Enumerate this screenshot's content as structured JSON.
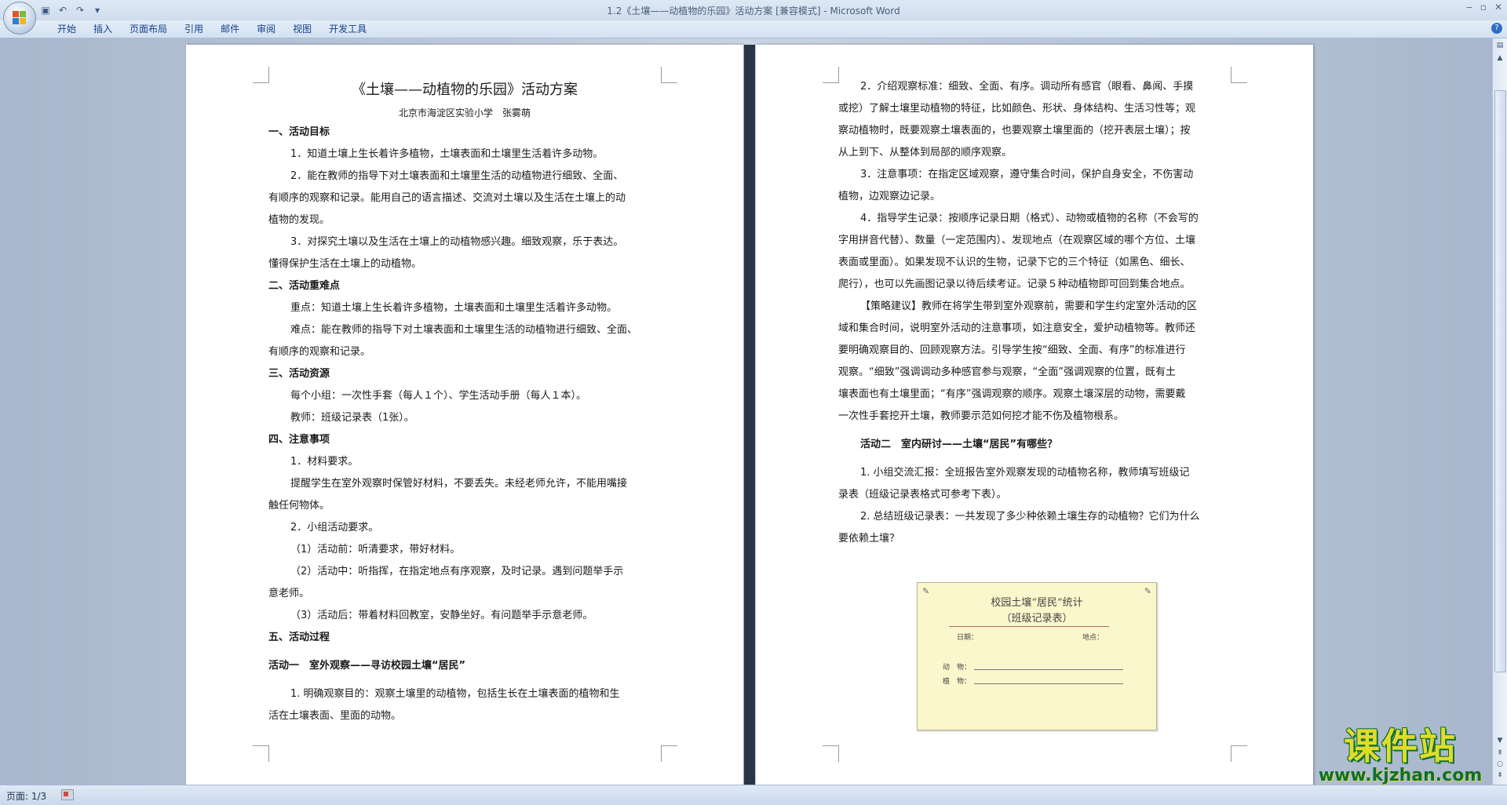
{
  "window": {
    "title": "1.2《土壤——动植物的乐园》活动方案 [兼容模式] - Microsoft Word",
    "controls": [
      "‒",
      "▫",
      "✕"
    ]
  },
  "quick_access": {
    "save_icon": "save-icon",
    "undo_icon": "undo-icon",
    "redo_icon": "redo-icon",
    "customize_icon": "customize-icon"
  },
  "menu_tabs": [
    "开始",
    "插入",
    "页面布局",
    "引用",
    "邮件",
    "审阅",
    "视图",
    "开发工具"
  ],
  "status": {
    "page": "页面: 1/3"
  },
  "page1": {
    "title": "《土壤——动植物的乐园》活动方案",
    "author": "北京市海淀区实验小学　张雾萌",
    "lines": [
      {
        "text": "一、活动目标",
        "style": "hd"
      },
      {
        "text": "1．知道土壤上生长着许多植物，土壤表面和土壤里生活着许多动物。",
        "style": "ind"
      },
      {
        "text": "2．能在教师的指导下对土壤表面和土壤里生活的动植物进行细致、全面、",
        "style": "ind"
      },
      {
        "text": "有顺序的观察和记录。能用自己的语言描述、交流对土壤以及生活在土壤上的动",
        "style": ""
      },
      {
        "text": "植物的发现。",
        "style": ""
      },
      {
        "text": "3．对探究土壤以及生活在土壤上的动植物感兴趣。细致观察，乐于表达。",
        "style": "ind"
      },
      {
        "text": "懂得保护生活在土壤上的动植物。",
        "style": ""
      },
      {
        "text": "二、活动重难点",
        "style": "hd"
      },
      {
        "text": "重点：知道土壤上生长着许多植物，土壤表面和土壤里生活着许多动物。",
        "style": "ind"
      },
      {
        "text": "难点：能在教师的指导下对土壤表面和土壤里生活的动植物进行细致、全面、",
        "style": "ind"
      },
      {
        "text": "有顺序的观察和记录。",
        "style": ""
      },
      {
        "text": "三、活动资源",
        "style": "hd"
      },
      {
        "text": "每个小组：一次性手套（每人１个）、学生活动手册（每人１本）。",
        "style": "ind"
      },
      {
        "text": "教师：班级记录表（1张）。",
        "style": "ind"
      },
      {
        "text": "四、注意事项",
        "style": "hd"
      },
      {
        "text": "1．材料要求。",
        "style": "ind"
      },
      {
        "text": "提醒学生在室外观察时保管好材料，不要丢失。未经老师允许，不能用嘴接",
        "style": "ind"
      },
      {
        "text": "触任何物体。",
        "style": ""
      },
      {
        "text": "2．小组活动要求。",
        "style": "ind"
      },
      {
        "text": "（1）活动前：听清要求，带好材料。",
        "style": "ind"
      },
      {
        "text": "（2）活动中：听指挥，在指定地点有序观察，及时记录。遇到问题举手示",
        "style": "ind"
      },
      {
        "text": "意老师。",
        "style": ""
      },
      {
        "text": "（3）活动后：带着材料回教室，安静坐好。有问题举手示意老师。",
        "style": "ind"
      },
      {
        "text": "五、活动过程",
        "style": "hd"
      },
      {
        "text": "",
        "style": "gap"
      },
      {
        "text": "活动一　室外观察——寻访校园土壤“居民”",
        "style": "hd"
      },
      {
        "text": "",
        "style": "gap"
      },
      {
        "text": "1. 明确观察目的：观察土壤里的动植物，包括生长在土壤表面的植物和生",
        "style": "ind"
      },
      {
        "text": "活在土壤表面、里面的动物。",
        "style": ""
      }
    ]
  },
  "page2": {
    "lines": [
      {
        "text": "2．介绍观察标准：细致、全面、有序。调动所有感官（眼看、鼻闻、手摸",
        "style": "ind"
      },
      {
        "text": "或挖）了解土壤里动植物的特征，比如颜色、形状、身体结构、生活习性等；观",
        "style": ""
      },
      {
        "text": "察动植物时，既要观察土壤表面的，也要观察土壤里面的（挖开表层土壤）；按",
        "style": ""
      },
      {
        "text": "从上到下、从整体到局部的顺序观察。",
        "style": ""
      },
      {
        "text": "3．注意事项：在指定区域观察，遵守集合时间，保护自身安全，不伤害动",
        "style": "ind"
      },
      {
        "text": "植物，边观察边记录。",
        "style": ""
      },
      {
        "text": "4．指导学生记录：按顺序记录日期（格式）、动物或植物的名称（不会写的",
        "style": "ind"
      },
      {
        "text": "字用拼音代替）、数量（一定范围内）、发现地点（在观察区域的哪个方位、土壤",
        "style": ""
      },
      {
        "text": "表面或里面）。如果发现不认识的生物，记录下它的三个特征（如黑色、细长、",
        "style": ""
      },
      {
        "text": "爬行），也可以先画图记录以待后续考证。记录５种动植物即可回到集合地点。",
        "style": ""
      },
      {
        "text": "【策略建议】教师在将学生带到室外观察前，需要和学生约定室外活动的区",
        "style": "ind"
      },
      {
        "text": "域和集合时间，说明室外活动的注意事项，如注意安全，爱护动植物等。教师还",
        "style": ""
      },
      {
        "text": "要明确观察目的、回顾观察方法。引导学生按“细致、全面、有序”的标准进行",
        "style": ""
      },
      {
        "text": "观察。“细致”强调调动多种感官参与观察，“全面”强调观察的位置，既有土",
        "style": ""
      },
      {
        "text": "壤表面也有土壤里面；“有序”强调观察的顺序。观察土壤深层的动物，需要戴",
        "style": ""
      },
      {
        "text": "一次性手套挖开土壤，教师要示范如何挖才能不伤及植物根系。",
        "style": ""
      },
      {
        "text": "",
        "style": "gap"
      },
      {
        "text": "活动二　室内研讨——土壤“居民”有哪些？",
        "style": "hd ind"
      },
      {
        "text": "",
        "style": "gap"
      },
      {
        "text": "1. 小组交流汇报：全班报告室外观察发现的动植物名称，教师填写班级记",
        "style": "ind"
      },
      {
        "text": "录表（班级记录表格式可参考下表）。",
        "style": ""
      },
      {
        "text": "2. 总结班级记录表：一共发现了多少种依赖土壤生存的动植物？它们为什么",
        "style": "ind"
      },
      {
        "text": "要依赖土壤？",
        "style": ""
      }
    ]
  },
  "record_card": {
    "title_line1": "校园土壤“居民”统计",
    "title_line2": "（班级记录表）",
    "date_label": "日期：",
    "place_label": "地点：",
    "animal_label": "动　物：",
    "plant_label": "植　物："
  },
  "watermark": {
    "line1": "课件站",
    "line2": "www.kjzhan.com"
  },
  "colors": {
    "ribbon_text": "#15428b",
    "workspace": "#b7c4d8",
    "card": "#fbf7cc",
    "watermark_yellow": "#e0dc2a",
    "watermark_green": "#0e6f35"
  }
}
